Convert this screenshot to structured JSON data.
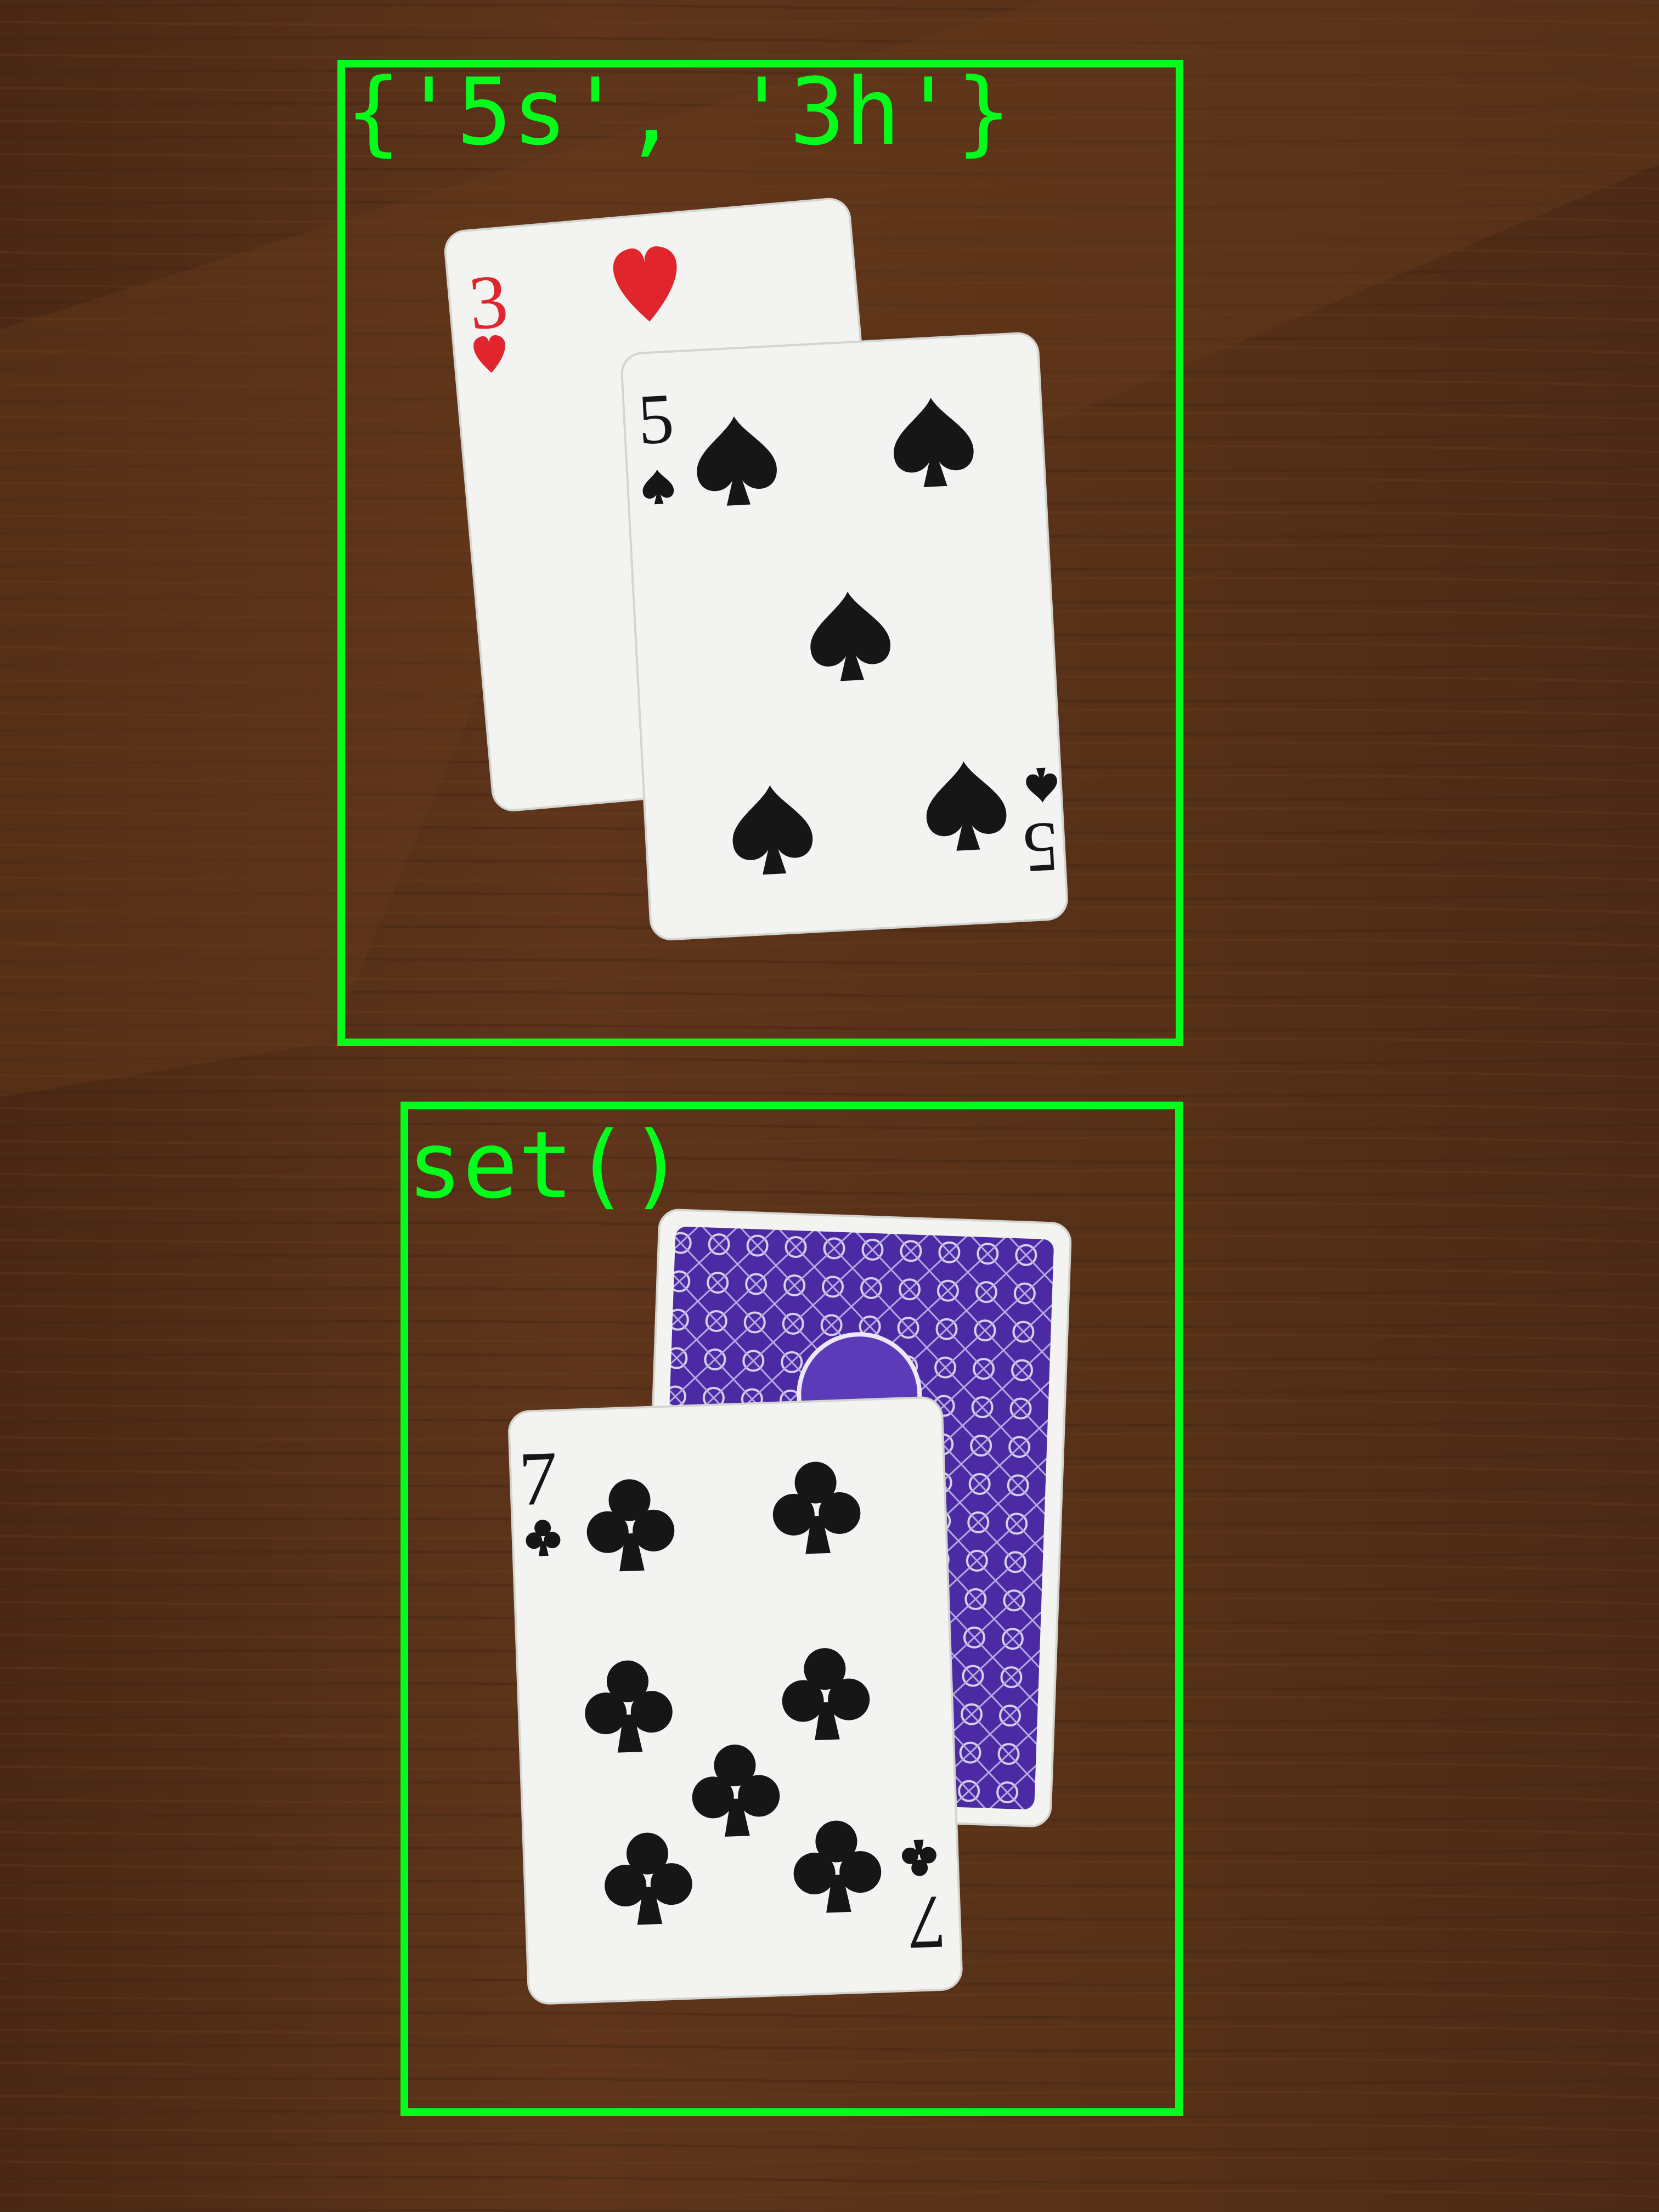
{
  "detections": [
    {
      "label": "{'5s', '3h'}"
    },
    {
      "label": "set()"
    }
  ],
  "cards": {
    "three_of_hearts": {
      "rank": "3",
      "suit": "heart"
    },
    "five_of_spades": {
      "rank": "5",
      "suit": "spade"
    },
    "seven_of_clubs": {
      "rank": "7",
      "suit": "club"
    },
    "card_back": {
      "color": "#4b2aa3"
    }
  },
  "colors": {
    "box": "#00ff1a",
    "table": "#5a3219",
    "card_face": "#f3f3f1",
    "red_suit": "#e0252c",
    "black_suit": "#161616"
  }
}
